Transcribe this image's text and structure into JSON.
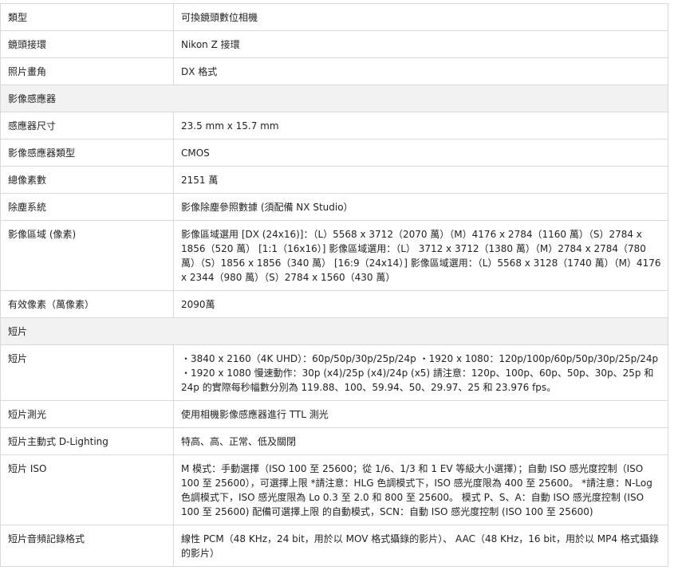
{
  "rows": [
    {
      "label": "類型",
      "value": "可換鏡頭數位相機"
    },
    {
      "label": "鏡頭接環",
      "value": "Nikon Z 接環"
    },
    {
      "label": "照片畫角",
      "value": "DX 格式"
    },
    {
      "label": "影像感應器",
      "value": "",
      "section": true
    },
    {
      "label": "感應器尺寸",
      "value": "23.5 mm x 15.7 mm"
    },
    {
      "label": "影像感應器類型",
      "value": "CMOS"
    },
    {
      "label": "總像素數",
      "value": "2151 萬"
    },
    {
      "label": "除塵系統",
      "value": "影像除塵參照數據 (須配備 NX Studio）"
    },
    {
      "label": "影像區域 (像素)",
      "value": "影像區域選用 [DX (24x16)]：（L）5568 x 3712（2070 萬）（M）4176 x 2784（1160 萬）（S）2784 x 1856（520 萬） [1:1（16x16）] 影像區域選用：（L） 3712 x 3712（1380 萬）（M）2784 x 2784（780 萬）（S）1856 x 1856（340 萬） [16:9（24x14）] 影像區域選用：（L）5568 x 3128（1740 萬）（M）4176 x 2344（980 萬）（S）2784 x 1560（430 萬）"
    },
    {
      "label": "有效像素（萬像素）",
      "value": "2090萬"
    },
    {
      "label": "短片",
      "value": "",
      "section": true
    },
    {
      "label": "短片",
      "value": "・3840 x 2160（4K UHD）：60p/50p/30p/25p/24p ・1920 x 1080：120p/100p/60p/50p/30p/25p/24p ・1920 x 1080 慢速動作：30p (x4)/25p (x4)/24p (x5) 請注意：120p、100p、60p、50p、30p、25p 和 24p 的實際每秒幅數分別為 119.88、100、59.94、50、29.97、25 和 23.976 fps。"
    },
    {
      "label": "短片測光",
      "value": "使用相機影像感應器進行 TTL 測光"
    },
    {
      "label": "短片主動式 D-Lighting",
      "value": "特高、高、正常、低及關閉"
    },
    {
      "label": "短片 ISO",
      "value": "M 模式：手動選擇（ISO 100 至 25600；從 1/6、1/3 和 1 EV 等級大小選擇）；自動 ISO 感光度控制（ISO 100 至 25600），可選擇上限 *請注意：HLG 色調模式下，ISO 感光度限為 400 至 25600。 *請注意：N-Log 色調模式下，ISO 感光度限為 Lo 0.3 至 2.0 和 800 至 25600。 模式 P、S、A：自動 ISO 感光度控制 (ISO 100 至 25600) 配備可選擇上限 的自動模式，SCN：自動 ISO 感光度控制 (ISO 100 至 25600)"
    },
    {
      "label": "短片音頻記錄格式",
      "value": "線性 PCM（48 KHz，24 bit，用於以 MOV 格式攝錄的影片）、 AAC（48 KHz，16 bit，用於以 MP4 格式攝錄的影片）"
    }
  ]
}
